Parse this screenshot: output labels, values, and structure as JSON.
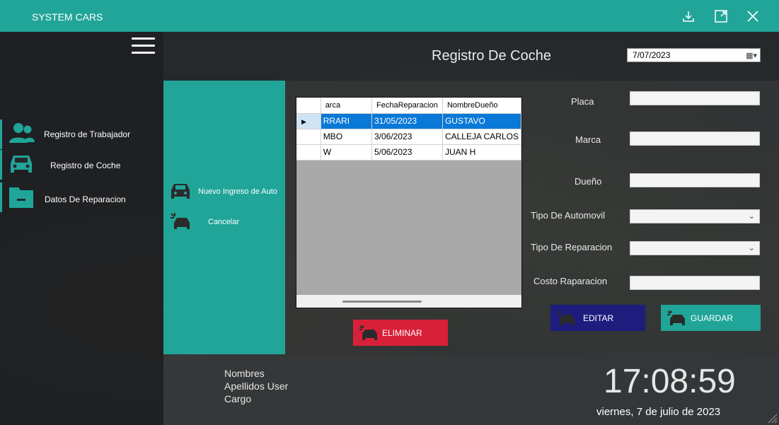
{
  "app": {
    "title": "SYSTEM CARS"
  },
  "window_controls": {
    "download_icon": "download-icon",
    "maximize_icon": "maximize-icon",
    "close_icon": "close-icon"
  },
  "sidebar": {
    "items": [
      {
        "label": "Registro de Trabajador",
        "icon": "users-icon"
      },
      {
        "label": "Registro de Coche",
        "icon": "car-icon"
      },
      {
        "label": "Datos De Reparacion",
        "icon": "folder-icon"
      }
    ]
  },
  "header": {
    "title": "Registro De Coche",
    "date_value": "7/07/2023"
  },
  "panel": {
    "new_entry_label": "Nuevo Ingreso de Auto",
    "cancel_label": "Cancelar"
  },
  "grid": {
    "columns": [
      "arca",
      "FechaReparacion",
      "NombreDueño"
    ],
    "rows": [
      [
        "RRARI",
        "31/05/2023",
        "GUSTAVO"
      ],
      [
        "MBO",
        "3/06/2023",
        "CALLEJA CARLOS"
      ],
      [
        "W",
        "5/06/2023",
        "JUAN H"
      ]
    ]
  },
  "form": {
    "placa_label": "Placa",
    "marca_label": "Marca",
    "dueno_label": "Dueño",
    "tipo_auto_label": "Tipo De Automovil",
    "tipo_rep_label": "Tipo De Reparacion",
    "costo_label": "Costo Raparacion",
    "placa_value": "",
    "marca_value": "",
    "dueno_value": "",
    "tipo_auto_value": "",
    "tipo_rep_value": "",
    "costo_value": ""
  },
  "buttons": {
    "eliminar": "ELIMINAR",
    "editar": "EDITAR",
    "guardar": "GUARDAR"
  },
  "footer": {
    "names": "Nombres",
    "surnames": "Apellidos User",
    "role": "Cargo",
    "time": "17:08:59",
    "date": "viernes, 7 de julio de 2023"
  },
  "colors": {
    "accent": "#21a599",
    "delete": "#d9203a",
    "edit": "#1d1d7e",
    "save": "#21a599"
  }
}
